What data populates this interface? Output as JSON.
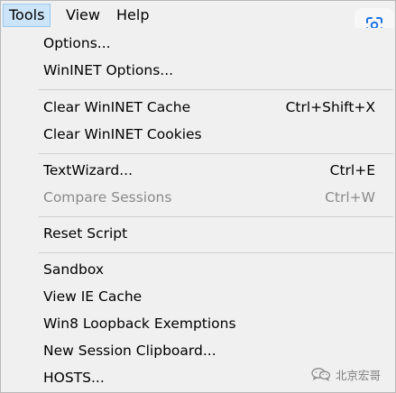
{
  "menubar": {
    "items": [
      {
        "label": "Tools",
        "active": true
      },
      {
        "label": "View",
        "active": false
      },
      {
        "label": "Help",
        "active": false
      }
    ]
  },
  "tools_menu": {
    "options": {
      "label": "Options..."
    },
    "wininet_options": {
      "label": "WinINET Options..."
    },
    "clear_cache": {
      "label": "Clear WinINET Cache",
      "shortcut": "Ctrl+Shift+X"
    },
    "clear_cookies": {
      "label": "Clear WinINET Cookies"
    },
    "text_wizard": {
      "label": "TextWizard...",
      "shortcut": "Ctrl+E"
    },
    "compare_sessions": {
      "label": "Compare Sessions",
      "shortcut": "Ctrl+W",
      "enabled": false
    },
    "reset_script": {
      "label": "Reset Script"
    },
    "sandbox": {
      "label": "Sandbox"
    },
    "view_ie_cache": {
      "label": "View IE Cache"
    },
    "win8_loopback": {
      "label": "Win8 Loopback Exemptions"
    },
    "new_session_clipboard": {
      "label": "New Session Clipboard..."
    },
    "hosts": {
      "label": "HOSTS..."
    }
  },
  "overlay": {
    "lens_icon": "google-lens-icon",
    "watermark_icon": "wechat-icon",
    "watermark_text": "北京宏哥"
  },
  "colors": {
    "menu_background": "#f0f0f0",
    "active_menubar_highlight": "#cce4f7",
    "active_menubar_border": "#99c9ef",
    "disabled_text": "#8a8a8a",
    "separator": "#cfcfcf"
  }
}
